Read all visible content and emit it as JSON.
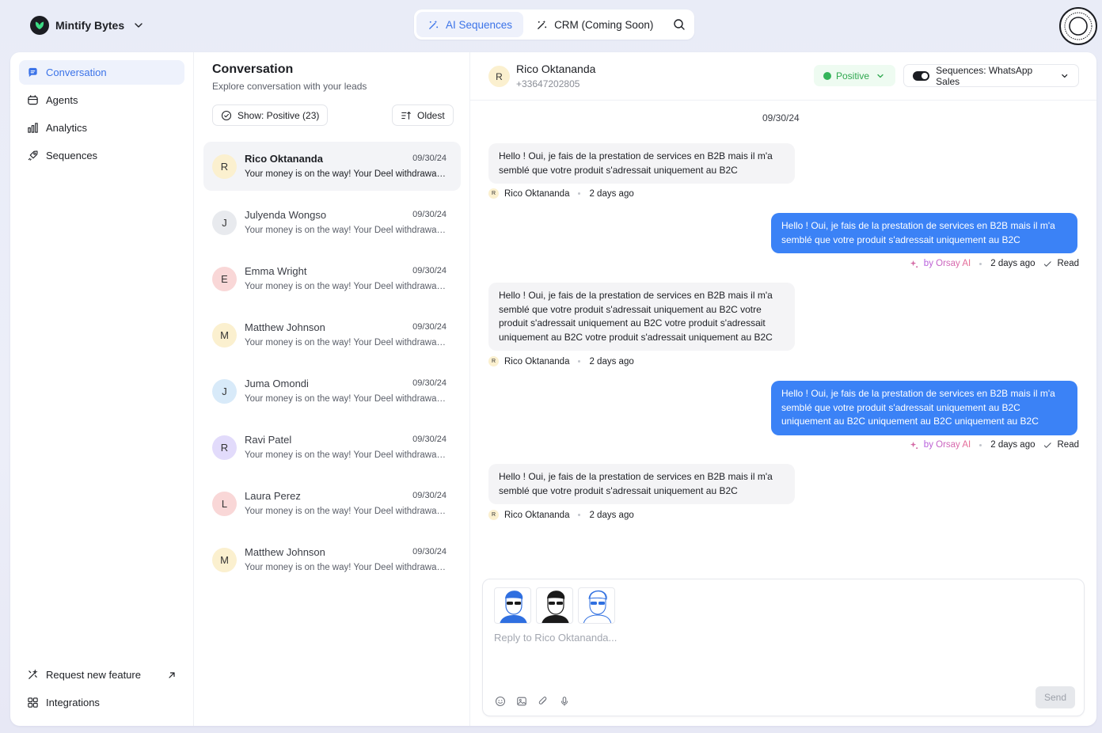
{
  "brand": {
    "name": "Mintify Bytes"
  },
  "topnav": {
    "tabs": [
      {
        "label": "AI Sequences"
      },
      {
        "label": "CRM (Coming Soon)"
      }
    ]
  },
  "sidebar": {
    "items": [
      {
        "label": "Conversation"
      },
      {
        "label": "Agents"
      },
      {
        "label": "Analytics"
      },
      {
        "label": "Sequences"
      }
    ],
    "footer": [
      {
        "label": "Request new feature"
      },
      {
        "label": "Integrations"
      }
    ]
  },
  "conversation_list": {
    "title": "Conversation",
    "subtitle": "Explore conversation with your leads",
    "filter_label": "Show: Positive (23)",
    "sort_label": "Oldest",
    "items": [
      {
        "initial": "R",
        "name": "Rico Oktananda",
        "date": "09/30/24",
        "preview": "Your money is on the way! Your Deel withdrawal is...",
        "color": "#fbf0cf"
      },
      {
        "initial": "J",
        "name": "Julyenda Wongso",
        "date": "09/30/24",
        "preview": "Your money is on the way! Your Deel withdrawal is...",
        "color": "#e8eaee"
      },
      {
        "initial": "E",
        "name": "Emma Wright",
        "date": "09/30/24",
        "preview": "Your money is on the way! Your Deel withdrawal is...",
        "color": "#f9d7d7"
      },
      {
        "initial": "M",
        "name": "Matthew Johnson",
        "date": "09/30/24",
        "preview": "Your money is on the way! Your Deel withdrawal is...",
        "color": "#fbf0cf"
      },
      {
        "initial": "J",
        "name": "Juma Omondi",
        "date": "09/30/24",
        "preview": "Your money is on the way! Your Deel withdrawal is...",
        "color": "#d8eaf9"
      },
      {
        "initial": "R",
        "name": "Ravi Patel",
        "date": "09/30/24",
        "preview": "Your money is on the way! Your Deel withdrawal is...",
        "color": "#e2dbfb"
      },
      {
        "initial": "L",
        "name": "Laura Perez",
        "date": "09/30/24",
        "preview": "Your money is on the way! Your Deel withdrawal is...",
        "color": "#f9d7d7"
      },
      {
        "initial": "M",
        "name": "Matthew Johnson",
        "date": "09/30/24",
        "preview": "Your money is on the way! Your Deel withdrawal is...",
        "color": "#fbf0cf"
      }
    ]
  },
  "chat": {
    "contact_initial": "R",
    "contact_name": "Rico Oktananda",
    "contact_phone": "+33647202805",
    "status_label": "Positive",
    "sequence_label": "Sequences: WhatsApp Sales",
    "date_separator": "09/30/24",
    "messages": [
      {
        "direction": "in",
        "text": "Hello ! Oui, je fais de la prestation de services en B2B mais il m'a semblé que votre produit s'adressait uniquement au B2C",
        "sender": "Rico Oktananda",
        "time": "2 days ago",
        "initial": "R"
      },
      {
        "direction": "out",
        "text": "Hello ! Oui, je fais de la prestation de services en B2B mais il m'a semblé que votre produit s'adressait uniquement au B2C",
        "sender": "by Orsay AI",
        "time": "2 days ago",
        "status": "Read"
      },
      {
        "direction": "in",
        "text": "Hello ! Oui, je fais de la prestation de services en B2B mais il m'a semblé que votre produit s'adressait uniquement au B2C votre produit s'adressait uniquement au B2C votre produit s'adressait uniquement au B2C votre produit s'adressait uniquement au B2C",
        "sender": "Rico Oktananda",
        "time": "2 days ago",
        "initial": "R"
      },
      {
        "direction": "out",
        "text": "Hello ! Oui, je fais de la prestation de services en B2B mais il m'a semblé que votre produit s'adressait uniquement au B2C uniquement au B2C uniquement au B2C uniquement au B2C",
        "sender": "by Orsay AI",
        "time": "2 days ago",
        "status": "Read"
      },
      {
        "direction": "in",
        "text": "Hello ! Oui, je fais de la prestation de services en B2B mais il m'a semblé que votre produit s'adressait uniquement au B2C",
        "sender": "Rico Oktananda",
        "time": "2 days ago",
        "initial": "R"
      }
    ]
  },
  "composer": {
    "placeholder": "Reply to Rico Oktananda...",
    "send_label": "Send"
  },
  "colors": {
    "accent": "#3b73e8",
    "bubble_out": "#3b82f6",
    "positive": "#2fa84f"
  }
}
